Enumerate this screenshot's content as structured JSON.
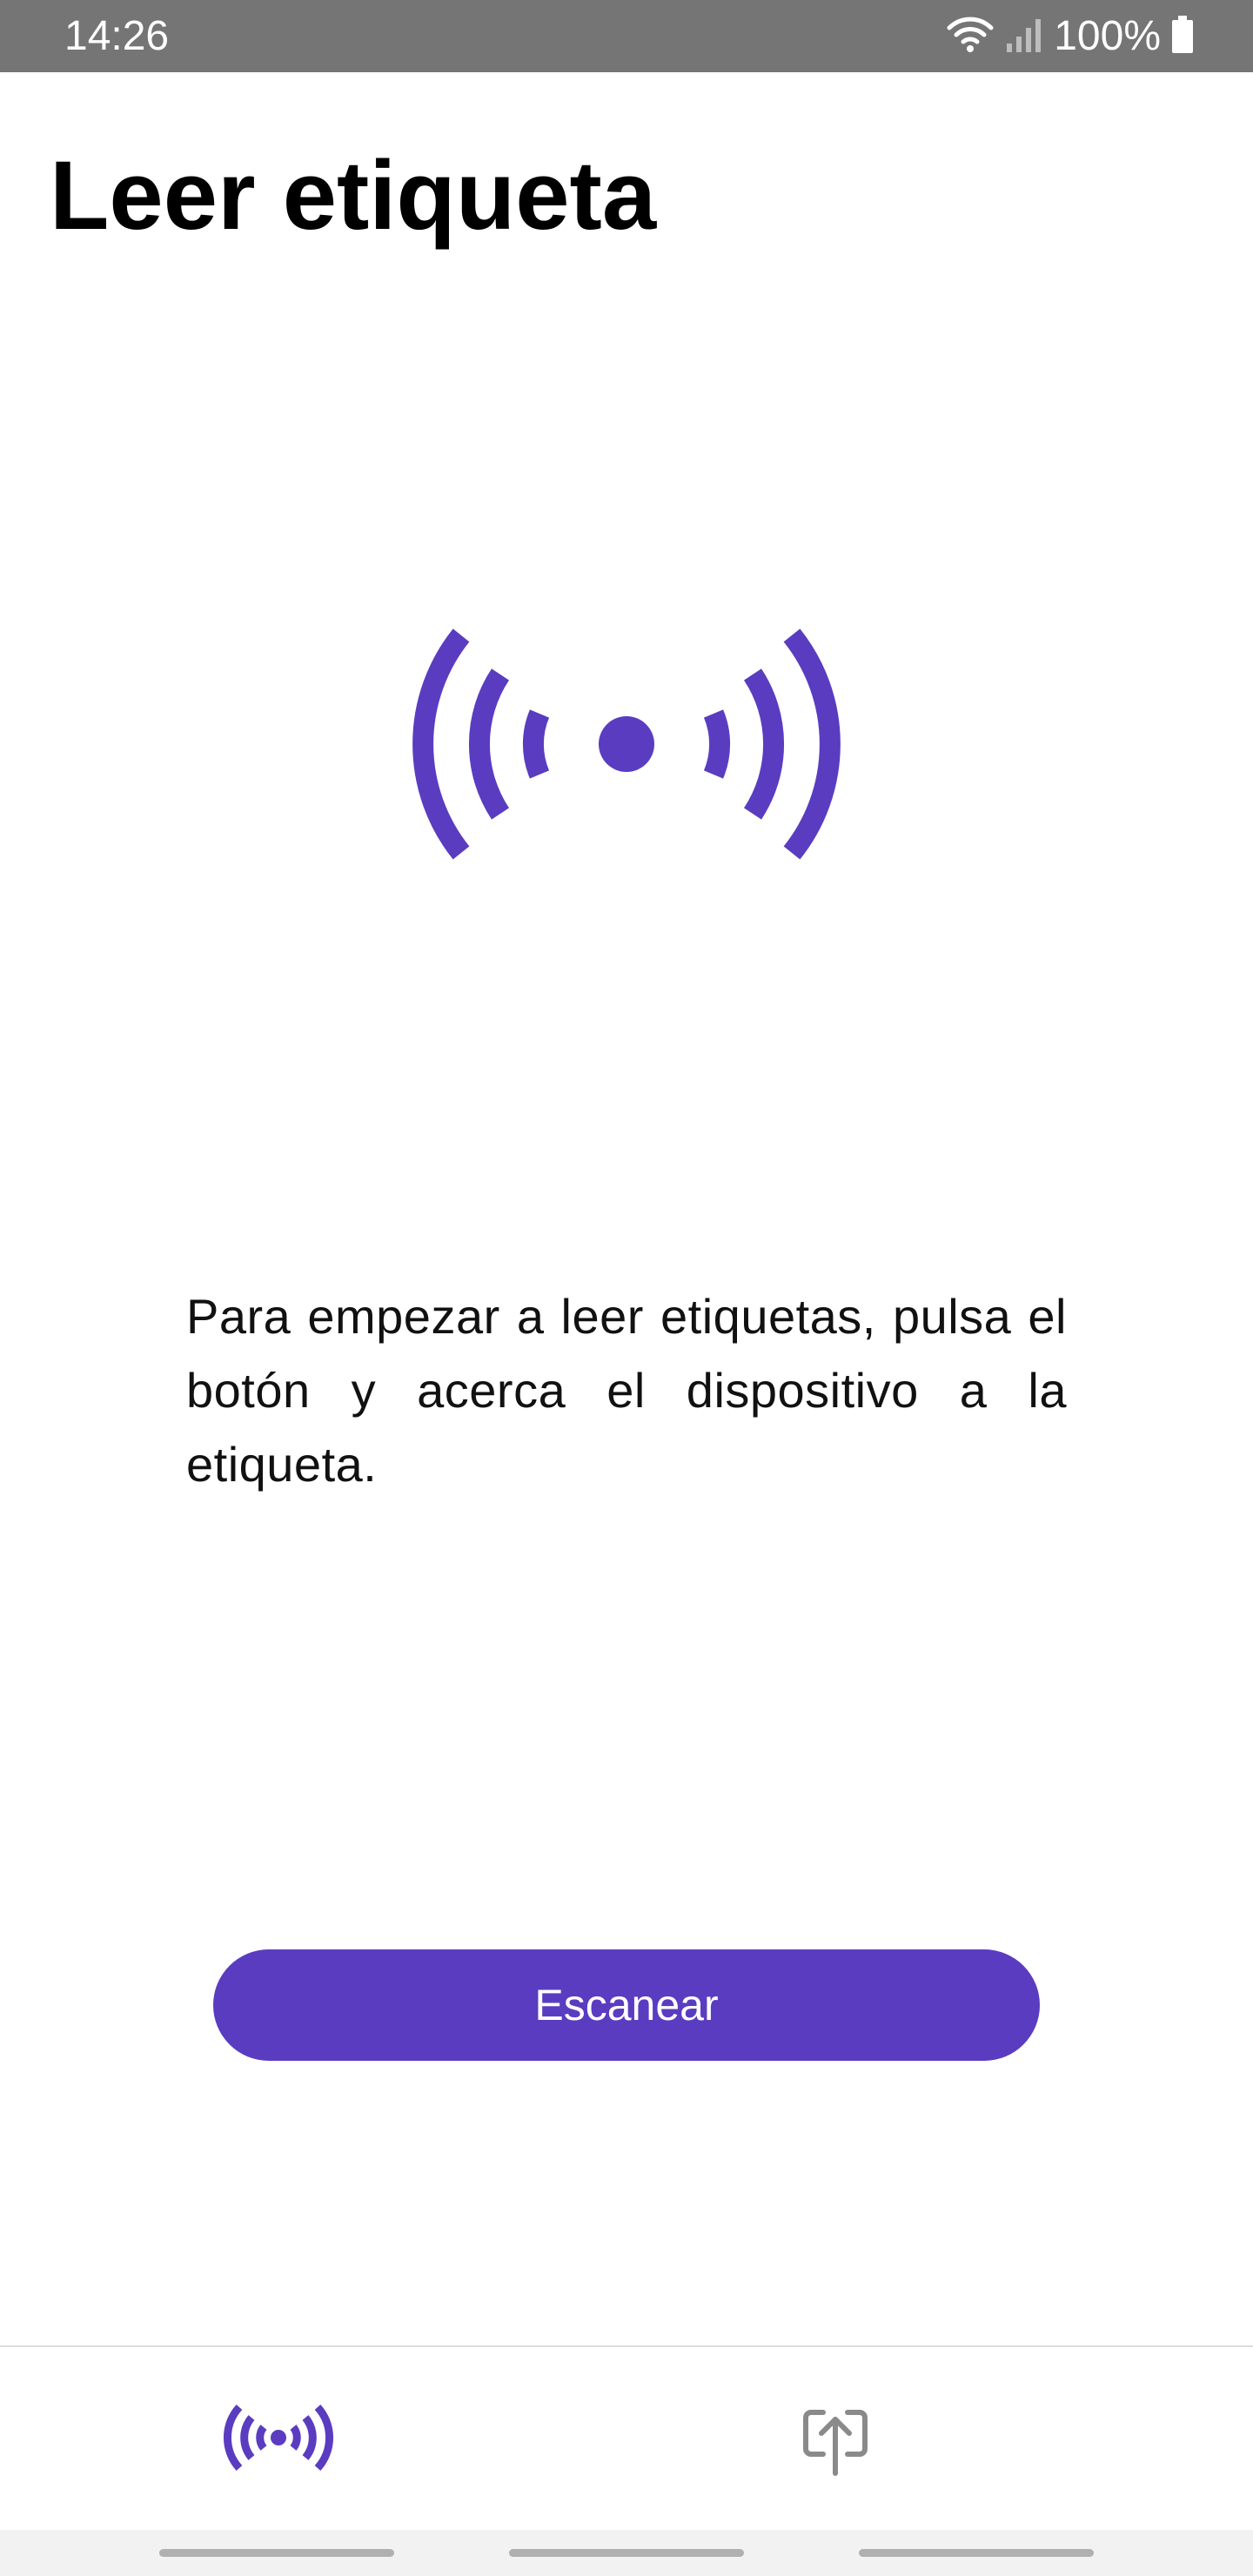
{
  "status_bar": {
    "time": "14:26",
    "battery_percent": "100%",
    "icons": [
      "wifi-icon",
      "signal-icon",
      "battery-icon"
    ]
  },
  "page": {
    "title": "Leer etiqueta",
    "hero_icon": "nfc-broadcast-icon",
    "instruction": "Para empezar a leer etiquetas, pulsa el botón y acerca el dispositivo a la etiqueta."
  },
  "actions": {
    "scan_label": "Escanear"
  },
  "bottom_nav": {
    "items": [
      {
        "icon": "nfc-scan-icon",
        "active": true
      },
      {
        "icon": "upload-icon",
        "active": false
      }
    ]
  },
  "colors": {
    "accent": "#5a3cc1",
    "status_bar": "#757575",
    "inactive_icon": "#8a8a8a"
  }
}
